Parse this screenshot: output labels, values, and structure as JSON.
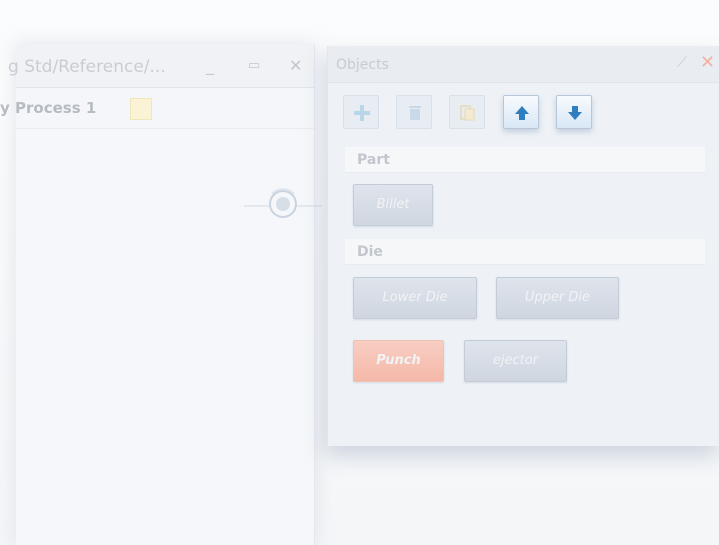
{
  "document": {
    "title": "g Std/Reference/...",
    "minimize": "_",
    "maximize": "▭",
    "close": "✕",
    "tab_label": "y Process 1"
  },
  "objects_panel": {
    "title": "Objects",
    "toolbar": [
      {
        "icon": "plus-icon"
      },
      {
        "icon": "trash-icon"
      },
      {
        "icon": "copy-icon"
      },
      {
        "icon": "arrow-up-icon"
      },
      {
        "icon": "arrow-down-icon"
      }
    ],
    "sections": {
      "part": {
        "header": "Part",
        "items": [
          "Billet"
        ]
      },
      "die": {
        "header": "Die",
        "items": [
          "Lower Die",
          "Upper Die",
          "Punch",
          "ejector"
        ]
      }
    }
  },
  "colors": {
    "accent_blue": "#2f7fc0",
    "punch": "#f4b8a8",
    "close_red": "#f3b0a6"
  }
}
